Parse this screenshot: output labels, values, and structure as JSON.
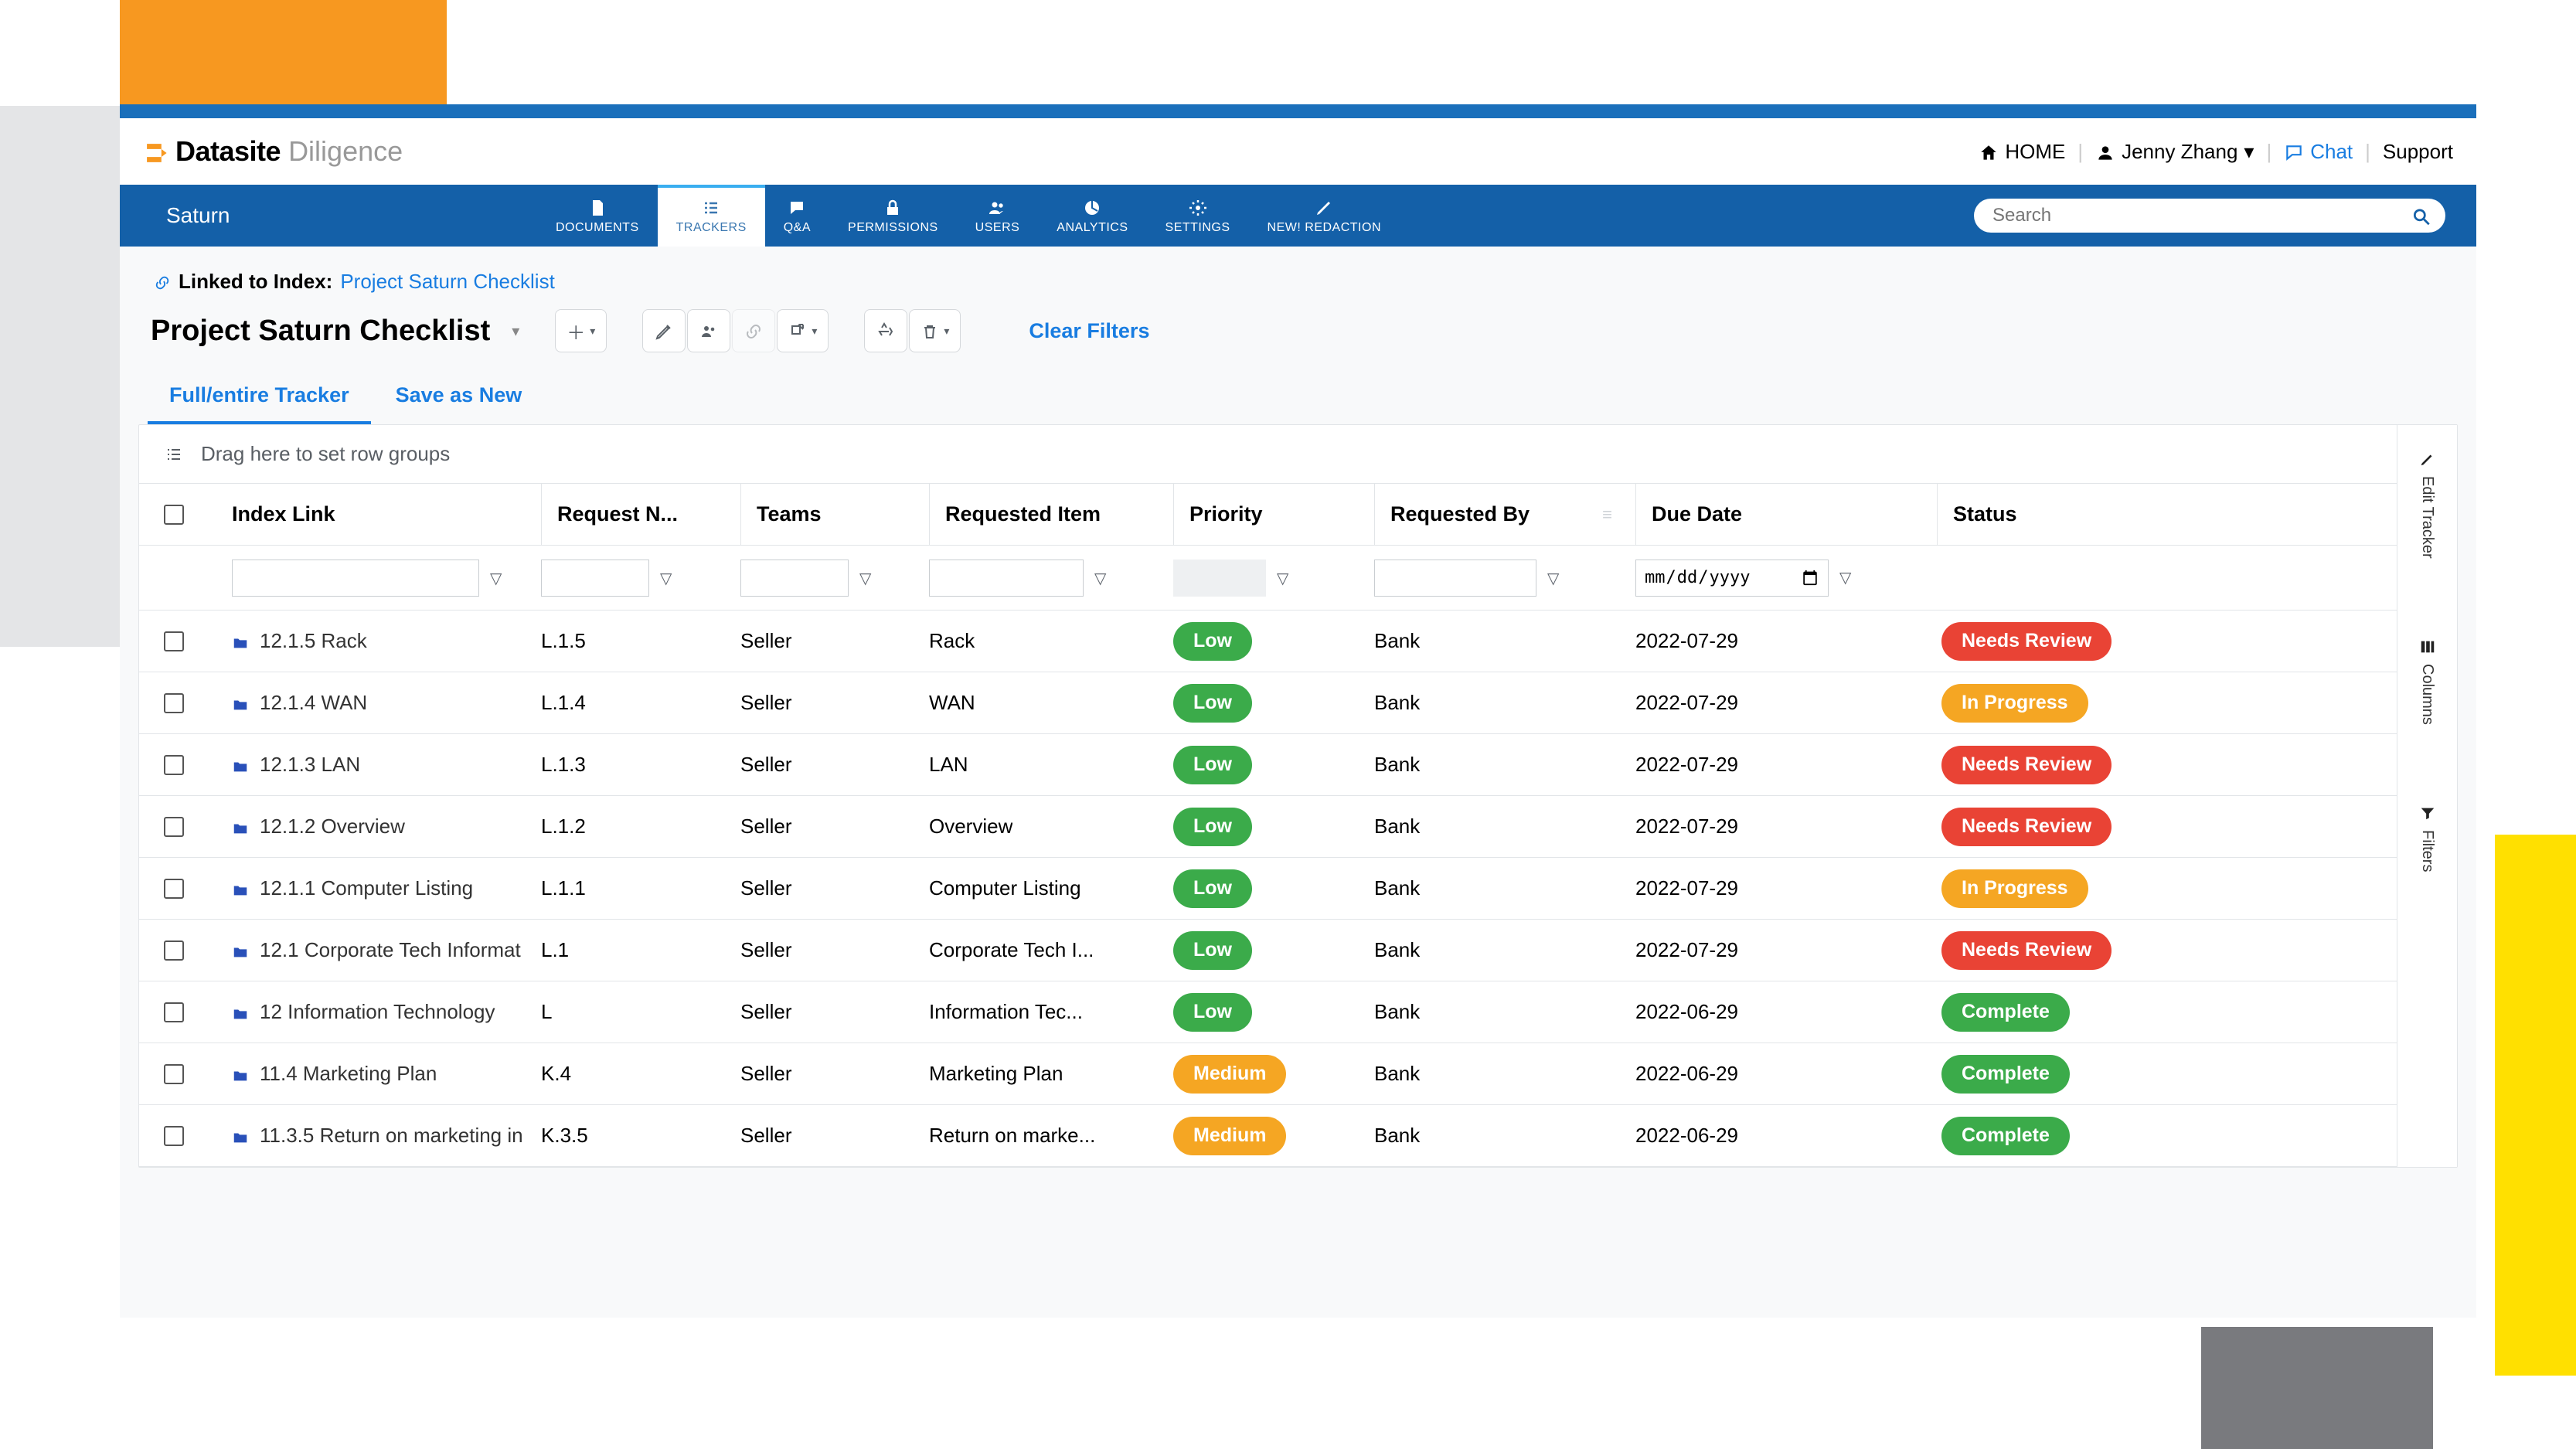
{
  "brand": {
    "name": "Datasite",
    "sub": "Diligence"
  },
  "topbar": {
    "home": "HOME",
    "user": "Jenny Zhang",
    "chat": "Chat",
    "support": "Support"
  },
  "project_name": "Saturn",
  "nav": [
    {
      "id": "documents",
      "label": "DOCUMENTS"
    },
    {
      "id": "trackers",
      "label": "TRACKERS"
    },
    {
      "id": "qa",
      "label": "Q&A"
    },
    {
      "id": "permissions",
      "label": "PERMISSIONS"
    },
    {
      "id": "users",
      "label": "USERS"
    },
    {
      "id": "analytics",
      "label": "ANALYTICS"
    },
    {
      "id": "settings",
      "label": "SETTINGS"
    },
    {
      "id": "redaction",
      "label": "NEW! REDACTION"
    }
  ],
  "search_placeholder": "Search",
  "linked": {
    "prefix": "Linked to Index:",
    "link_text": "Project Saturn Checklist"
  },
  "tracker_title": "Project Saturn Checklist",
  "clear_filters": "Clear Filters",
  "tabs": {
    "full": "Full/entire Tracker",
    "save_new": "Save as New"
  },
  "group_hint": "Drag here to set row groups",
  "date_placeholder": "mm/dd/yyyy",
  "columns": {
    "index": "Index Link",
    "reqname": "Request N...",
    "teams": "Teams",
    "reqitem": "Requested Item",
    "priority": "Priority",
    "reqby": "Requested By",
    "due": "Due Date",
    "status": "Status"
  },
  "side_tabs": {
    "edit": "Edit Tracker",
    "columns": "Columns",
    "filters": "Filters"
  },
  "rows": [
    {
      "index": "12.1.5 Rack",
      "reqname": "L.1.5",
      "teams": "Seller",
      "reqitem": "Rack",
      "priority": "Low",
      "reqby": "Bank",
      "due": "2022-07-29",
      "status": "Needs Review"
    },
    {
      "index": "12.1.4 WAN",
      "reqname": "L.1.4",
      "teams": "Seller",
      "reqitem": "WAN",
      "priority": "Low",
      "reqby": "Bank",
      "due": "2022-07-29",
      "status": "In Progress"
    },
    {
      "index": "12.1.3 LAN",
      "reqname": "L.1.3",
      "teams": "Seller",
      "reqitem": "LAN",
      "priority": "Low",
      "reqby": "Bank",
      "due": "2022-07-29",
      "status": "Needs Review"
    },
    {
      "index": "12.1.2 Overview",
      "reqname": "L.1.2",
      "teams": "Seller",
      "reqitem": "Overview",
      "priority": "Low",
      "reqby": "Bank",
      "due": "2022-07-29",
      "status": "Needs Review"
    },
    {
      "index": "12.1.1 Computer Listing",
      "reqname": "L.1.1",
      "teams": "Seller",
      "reqitem": "Computer Listing",
      "priority": "Low",
      "reqby": "Bank",
      "due": "2022-07-29",
      "status": "In Progress"
    },
    {
      "index": "12.1 Corporate Tech Informat",
      "reqname": "L.1",
      "teams": "Seller",
      "reqitem": "Corporate Tech I...",
      "priority": "Low",
      "reqby": "Bank",
      "due": "2022-07-29",
      "status": "Needs Review"
    },
    {
      "index": "12 Information Technology",
      "reqname": "L",
      "teams": "Seller",
      "reqitem": "Information Tec...",
      "priority": "Low",
      "reqby": "Bank",
      "due": "2022-06-29",
      "status": "Complete"
    },
    {
      "index": "11.4 Marketing Plan",
      "reqname": "K.4",
      "teams": "Seller",
      "reqitem": "Marketing Plan",
      "priority": "Medium",
      "reqby": "Bank",
      "due": "2022-06-29",
      "status": "Complete"
    },
    {
      "index": "11.3.5 Return on marketing in",
      "reqname": "K.3.5",
      "teams": "Seller",
      "reqitem": "Return on marke...",
      "priority": "Medium",
      "reqby": "Bank",
      "due": "2022-06-29",
      "status": "Complete"
    }
  ]
}
